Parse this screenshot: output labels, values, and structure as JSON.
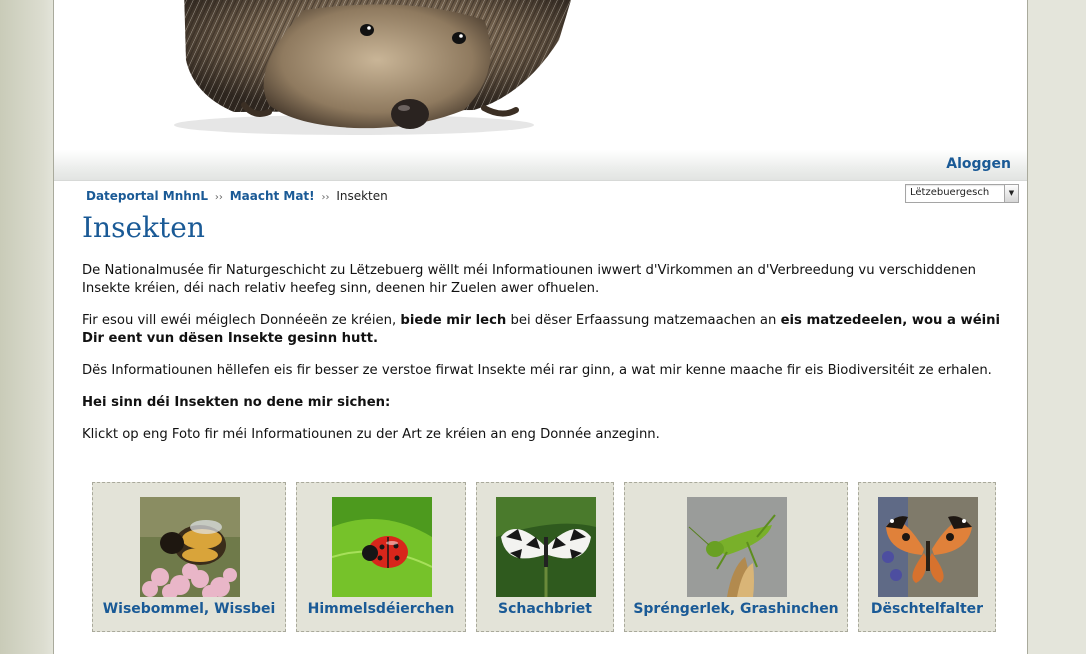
{
  "header": {
    "login_label": "Aloggen"
  },
  "breadcrumb": {
    "items": [
      "Dateportal MnhnL",
      "Maacht Mat!"
    ],
    "current": "Insekten",
    "separator": "››"
  },
  "language_select": {
    "selected": "Lëtzebuergesch"
  },
  "page": {
    "title": "Insekten",
    "intro": "De Nationalmusée fir Naturgeschicht zu Lëtzebuerg wëllt méi Informatiounen iwwert d'Virkommen an d'Verbreedung vu verschiddenen Insekte kréien, déi nach relativ heefeg sinn, deenen hir Zuelen awer ofhuelen.",
    "p2_part1": "Fir esou vill ewéi méiglech Donnéeën ze kréien, ",
    "p2_bold1": "biede mir lech",
    "p2_part2": " bei dëser Erfaassung matzemaachen an ",
    "p2_bold2": "eis matzedeelen, wou a wéini Dir eent vun dësen Insekte gesinn hutt.",
    "p3": "Dës Informatiounen hëllefen eis fir besser ze verstoe firwat Insekte méi rar ginn, a wat mir kenne maache fir eis Biodiversitéit ze erhalen.",
    "p4": "Hei sinn déi Insekten no dene mir sichen:",
    "p5": "Klickt op eng Foto fir méi Informatiounen zu der Art ze kréien an eng Donnée anzeginn."
  },
  "species": [
    {
      "name": "Wisebommel, Wissbei",
      "icon": "bumblebee-photo"
    },
    {
      "name": "Himmelsdéierchen",
      "icon": "ladybird-photo"
    },
    {
      "name": "Schachbriet",
      "icon": "marbled-white-butterfly-photo"
    },
    {
      "name": "Spréngerlek, Grashinchen",
      "icon": "grasshopper-photo"
    },
    {
      "name": "Dëschtelfalter",
      "icon": "painted-lady-butterfly-photo"
    }
  ],
  "colors": {
    "link": "#1a5a96",
    "tile_bg": "#e3e3d8"
  }
}
